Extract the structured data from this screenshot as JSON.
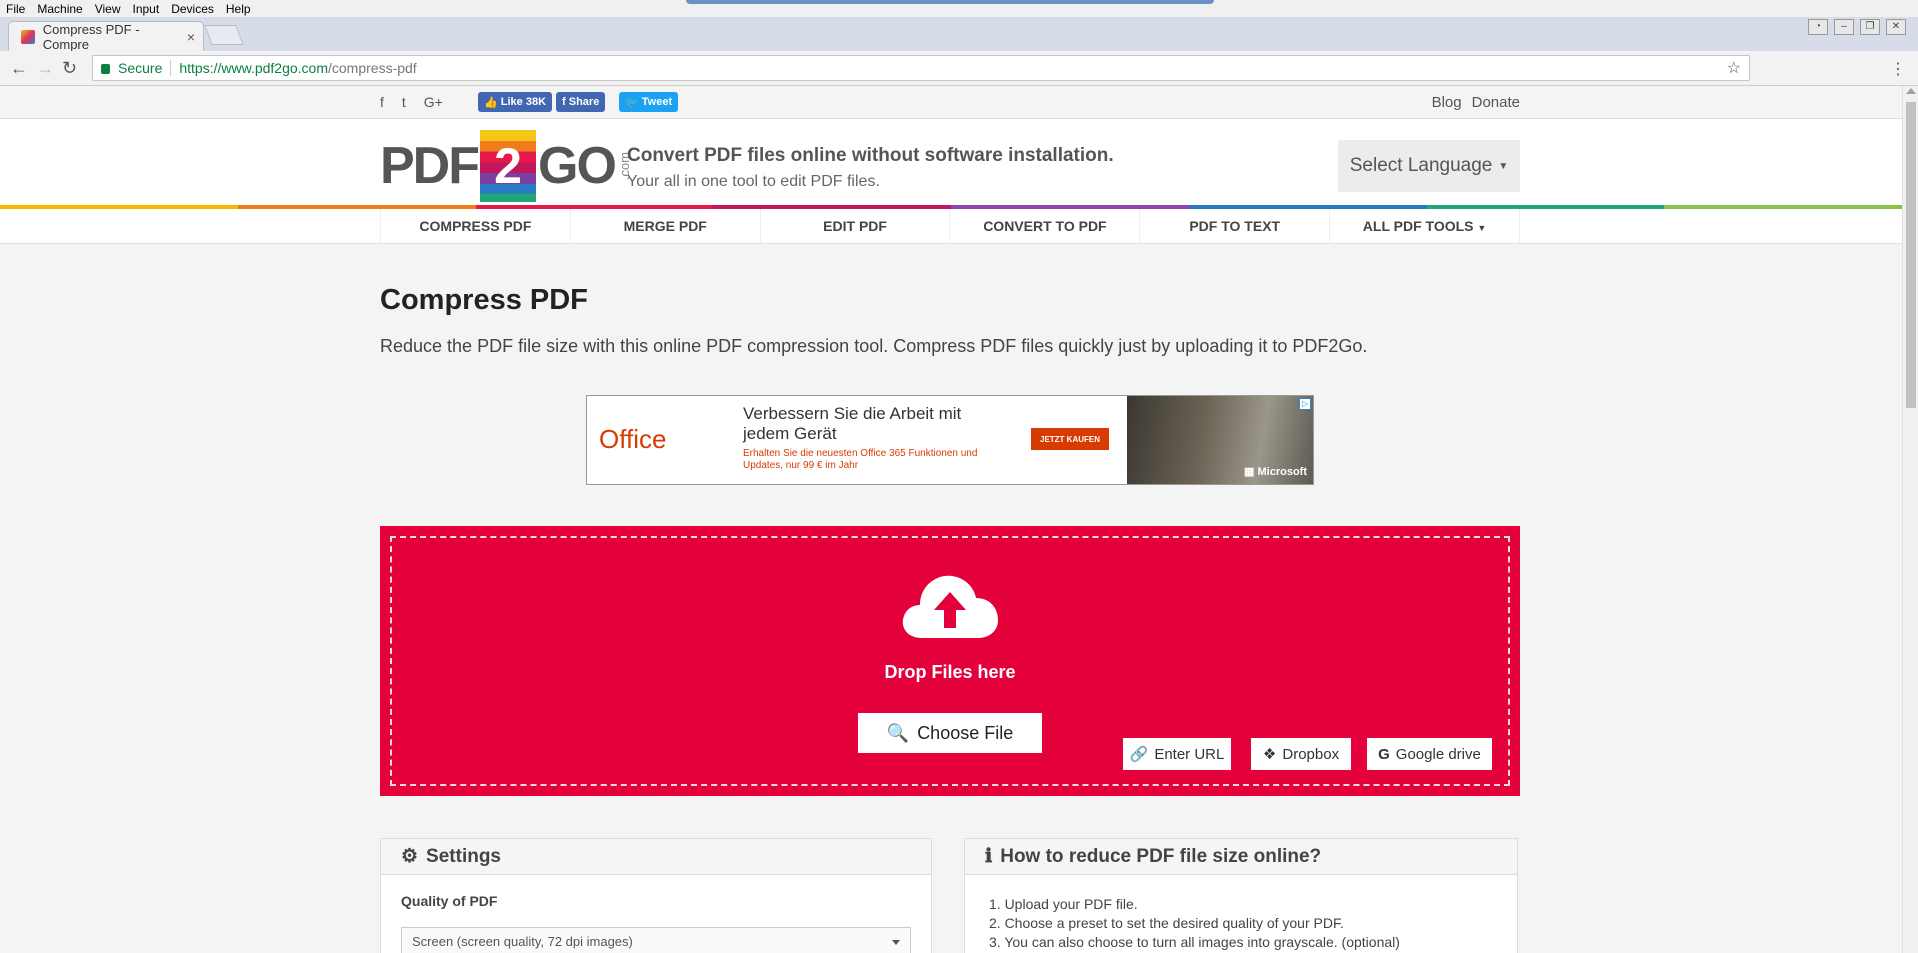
{
  "vm_menu": [
    "File",
    "Machine",
    "View",
    "Input",
    "Devices",
    "Help"
  ],
  "browser": {
    "tab_title": "Compress PDF - Compre",
    "tab_close": "×",
    "secure_label": "Secure",
    "url_host": "https://www.pdf2go.com",
    "url_path": "/compress-pdf"
  },
  "social": {
    "icons": [
      "facebook-icon",
      "twitter-icon",
      "google-plus-icon"
    ],
    "like_label": "Like 38K",
    "share_label": "Share",
    "tweet_label": "Tweet",
    "blog": "Blog",
    "donate": "Donate",
    "colors": {
      "facebook": "#4267b2",
      "twitter": "#1da1f2"
    }
  },
  "header": {
    "logo_pdf": "PDF",
    "logo_two": "2",
    "logo_go": "GO",
    "logo_com": ".com",
    "tagline": "Convert PDF files online without software installation.",
    "subtagline": "Your all in one tool to edit PDF files.",
    "language": "Select Language"
  },
  "rainbow_colors": [
    "#f5b800",
    "#ef7d1a",
    "#e6194b",
    "#c2185b",
    "#8e44ad",
    "#2979c6",
    "#21a67a",
    "#8bc34a"
  ],
  "nav": [
    "COMPRESS PDF",
    "MERGE PDF",
    "EDIT PDF",
    "CONVERT TO PDF",
    "PDF TO TEXT",
    "ALL PDF TOOLS"
  ],
  "main": {
    "title": "Compress PDF",
    "lead": "Reduce the PDF file size with this online PDF compression tool. Compress PDF files quickly just by uploading it to PDF2Go."
  },
  "ad": {
    "brand": "Office",
    "headline": "Verbessern Sie die Arbeit mit jedem Gerät",
    "subtext": "Erhalten Sie die neuesten Office 365 Funktionen und Updates, nur 99 € im Jahr",
    "cta": "JETZT KAUFEN",
    "advertiser": "Microsoft"
  },
  "upload": {
    "drop_text": "Drop Files here",
    "choose_file": "Choose File",
    "enter_url": "Enter URL",
    "dropbox": "Dropbox",
    "google_drive": "Google drive",
    "accent": "#e4003a"
  },
  "settings": {
    "title": "Settings",
    "quality_label": "Quality of PDF",
    "quality_value": "Screen (screen quality, 72 dpi images)"
  },
  "howto": {
    "title": "How to reduce PDF file size online?",
    "steps": [
      "1. Upload your PDF file.",
      "2. Choose a preset to set the desired quality of your PDF.",
      "3. You can also choose to turn all images into grayscale. (optional)"
    ]
  }
}
